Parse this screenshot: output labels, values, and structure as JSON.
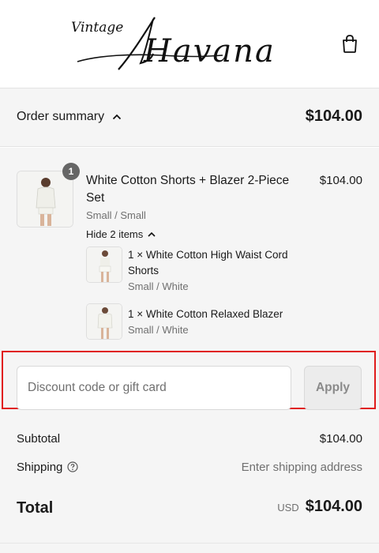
{
  "brand": {
    "logo_small": "Vintage",
    "logo_large": "Havana"
  },
  "summary": {
    "toggle_label": "Order summary",
    "total": "$104.00"
  },
  "item": {
    "quantity": "1",
    "title": "White Cotton Shorts + Blazer 2-Piece Set",
    "price": "$104.00",
    "variant": "Small / Small",
    "hide_label": "Hide 2 items",
    "components": [
      {
        "name": "1 × White Cotton High Waist Cord Shorts",
        "variant": "Small / White"
      },
      {
        "name": "1 × White Cotton Relaxed Blazer",
        "variant": "Small / White"
      }
    ]
  },
  "discount": {
    "placeholder": "Discount code or gift card",
    "apply_label": "Apply"
  },
  "totals": {
    "subtotal_label": "Subtotal",
    "subtotal_value": "$104.00",
    "shipping_label": "Shipping",
    "shipping_value": "Enter shipping address",
    "total_label": "Total",
    "currency": "USD",
    "total_value": "$104.00"
  },
  "icons": {
    "cart": "shopping-bag-icon",
    "toggle": "chevron-up-icon",
    "help": "question-circle-icon"
  },
  "colors": {
    "highlight": "#e01b1b",
    "badge": "#666666",
    "panel": "#f5f5f5"
  }
}
